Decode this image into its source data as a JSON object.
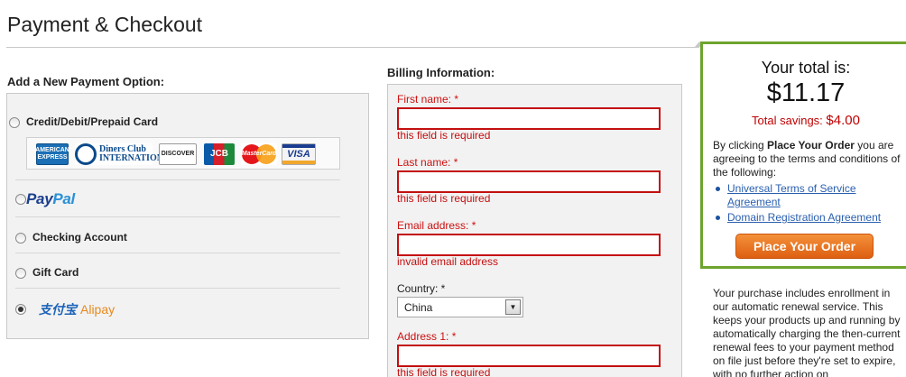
{
  "page": {
    "title": "Payment & Checkout"
  },
  "payment": {
    "heading": "Add a New Payment Option:",
    "options": [
      {
        "label": "Credit/Debit/Prepaid Card",
        "selected": false
      },
      {
        "label": "PayPal",
        "selected": false
      },
      {
        "label": "Checking Account",
        "selected": false
      },
      {
        "label": "Gift Card",
        "selected": false
      },
      {
        "label": "Alipay",
        "selected": true
      }
    ],
    "cards": {
      "amex": "AMERICAN EXPRESS",
      "diners": "Diners Club INTERNATIONAL",
      "discover": "DISCOVER",
      "jcb": "JCB",
      "mastercard": "MasterCard",
      "visa": "VISA"
    },
    "paypal_logo": {
      "pay": "Pay",
      "pal": "Pal"
    },
    "alipay_logo": {
      "cn": "支付宝",
      "en": "Alipay"
    }
  },
  "billing": {
    "heading": "Billing Information:",
    "first_name": {
      "label": "First name: *",
      "value": "",
      "error": "this field is required"
    },
    "last_name": {
      "label": "Last name: *",
      "value": "",
      "error": "this field is required"
    },
    "email": {
      "label": "Email address: *",
      "value": "",
      "error": "invalid email address"
    },
    "country": {
      "label": "Country: *",
      "selected": "China"
    },
    "address1": {
      "label": "Address 1: *",
      "value": "",
      "error": "this field is required"
    }
  },
  "summary": {
    "total_label": "Your total is:",
    "total_amount": "$11.17",
    "savings_label": "Total savings:",
    "savings_amount": "$4.00",
    "agree_text_pre": "By clicking ",
    "agree_text_bold": "Place Your Order",
    "agree_text_post": " you are agreeing to the terms and conditions of the following:",
    "links": [
      "Universal Terms of Service Agreement",
      "Domain Registration Agreement"
    ],
    "place_order_label": "Place Your Order",
    "renewal_text": "Your purchase includes enrollment in our automatic renewal service. This keeps your products up and running by automatically charging the then-current renewal fees to your payment method on file just before they're set to expire, with no further action on"
  },
  "colors": {
    "accent_green": "#6da42d",
    "error_red": "#c40f0f",
    "button_orange": "#e8741f",
    "link_blue": "#2a5fae"
  },
  "icons": [
    "radio-button",
    "select-arrow-icon",
    "bullet-icon"
  ]
}
